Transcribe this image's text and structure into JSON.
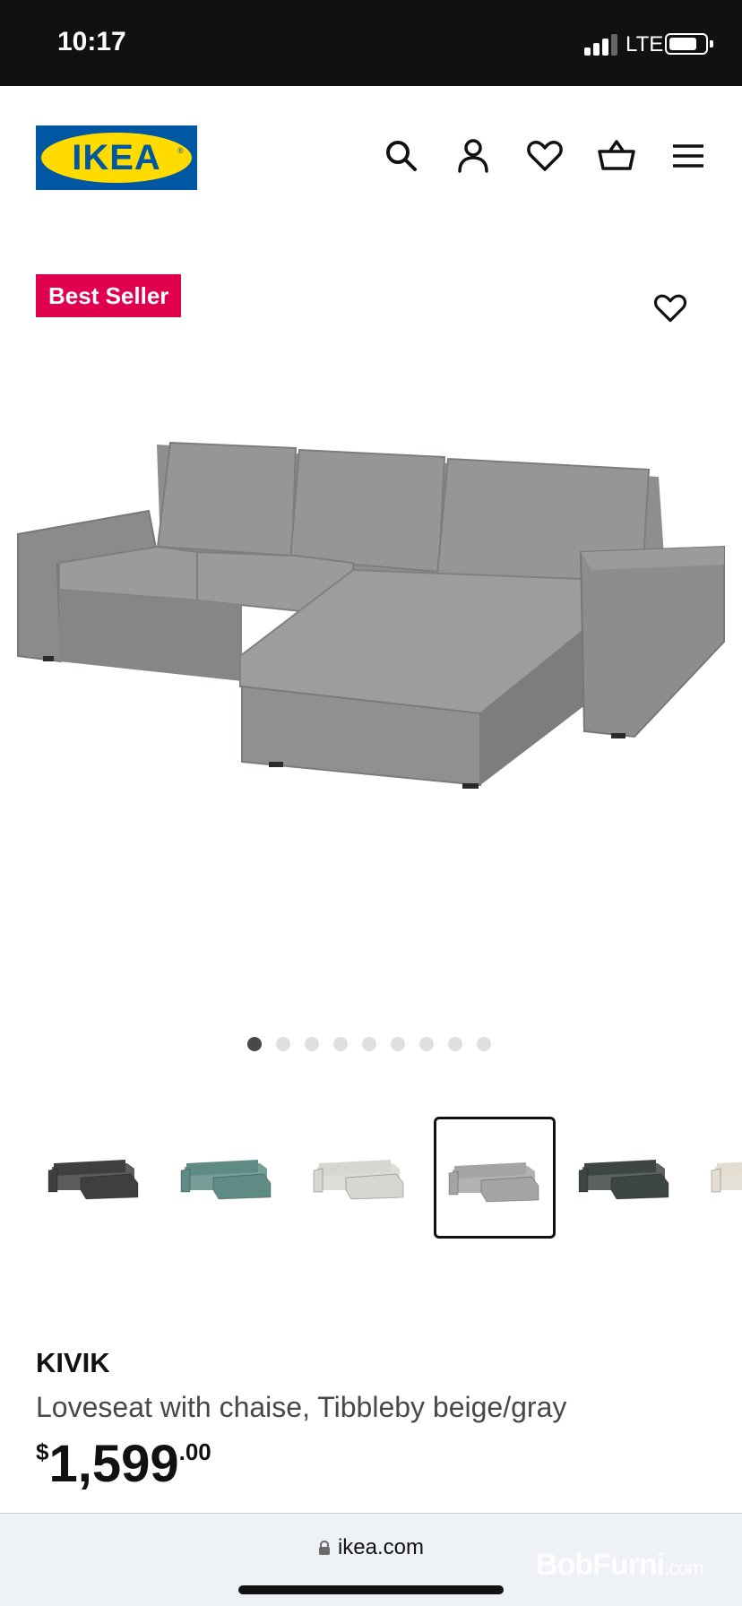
{
  "status_bar": {
    "time": "10:17",
    "network": "LTE",
    "signal_bars": 3,
    "battery_level": 0.8
  },
  "header": {
    "logo_text": "IKEA",
    "icons": [
      "search-icon",
      "account-icon",
      "heart-icon",
      "basket-icon",
      "menu-icon"
    ]
  },
  "product": {
    "badge": "Best Seller",
    "name": "KIVIK",
    "description": "Loveseat with chaise, Tibbleby beige/gray",
    "price": {
      "currency": "$",
      "main": "1,599",
      "decimals": ".00"
    }
  },
  "carousel": {
    "total": 9,
    "active_index": 0
  },
  "color_variants": [
    {
      "color": "#3d3f41",
      "selected": false
    },
    {
      "color": "#5e8c85",
      "selected": false
    },
    {
      "color": "#d8d6d1",
      "selected": false
    },
    {
      "color": "#a3a4a3",
      "selected": true
    },
    {
      "color": "#3e4644",
      "selected": false
    },
    {
      "color": "#e3ddd2",
      "selected": false
    }
  ],
  "browser": {
    "url": "ikea.com"
  },
  "watermark": {
    "brand": "BobFurni",
    "suffix": ".com"
  },
  "colors": {
    "brand_blue": "#0058a3",
    "brand_yellow": "#ffdb00",
    "badge_red": "#e0004d"
  }
}
